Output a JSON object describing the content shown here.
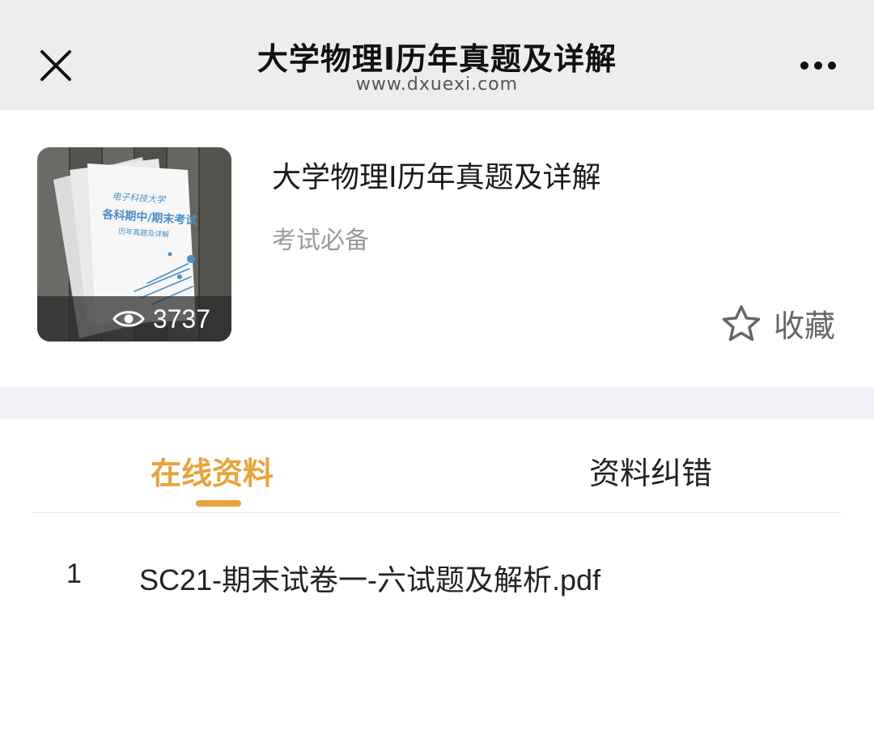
{
  "nav": {
    "title": "大学物理I历年真题及详解",
    "url": "www.dxuexi.com"
  },
  "info": {
    "title": "大学物理I历年真题及详解",
    "subtitle": "考试必备",
    "view_count": "3737",
    "favorite_label": "收藏",
    "cover": {
      "school": "电子科技大学",
      "heading": "各科期中/期末考试",
      "caption": "历年真题及详解"
    }
  },
  "tabs": [
    {
      "label": "在线资料",
      "active": true
    },
    {
      "label": "资料纠错",
      "active": false
    }
  ],
  "files": [
    {
      "index": "1",
      "name": "SC21-期末试卷一-六试题及解析.pdf"
    }
  ],
  "colors": {
    "accent": "#e8a33a",
    "navbar_bg": "#ededed",
    "separator_bg": "#f1f3f6"
  },
  "icons": {
    "close": "close-icon",
    "more": "more-icon",
    "views": "eye-icon",
    "favorite": "star-outline-icon"
  }
}
